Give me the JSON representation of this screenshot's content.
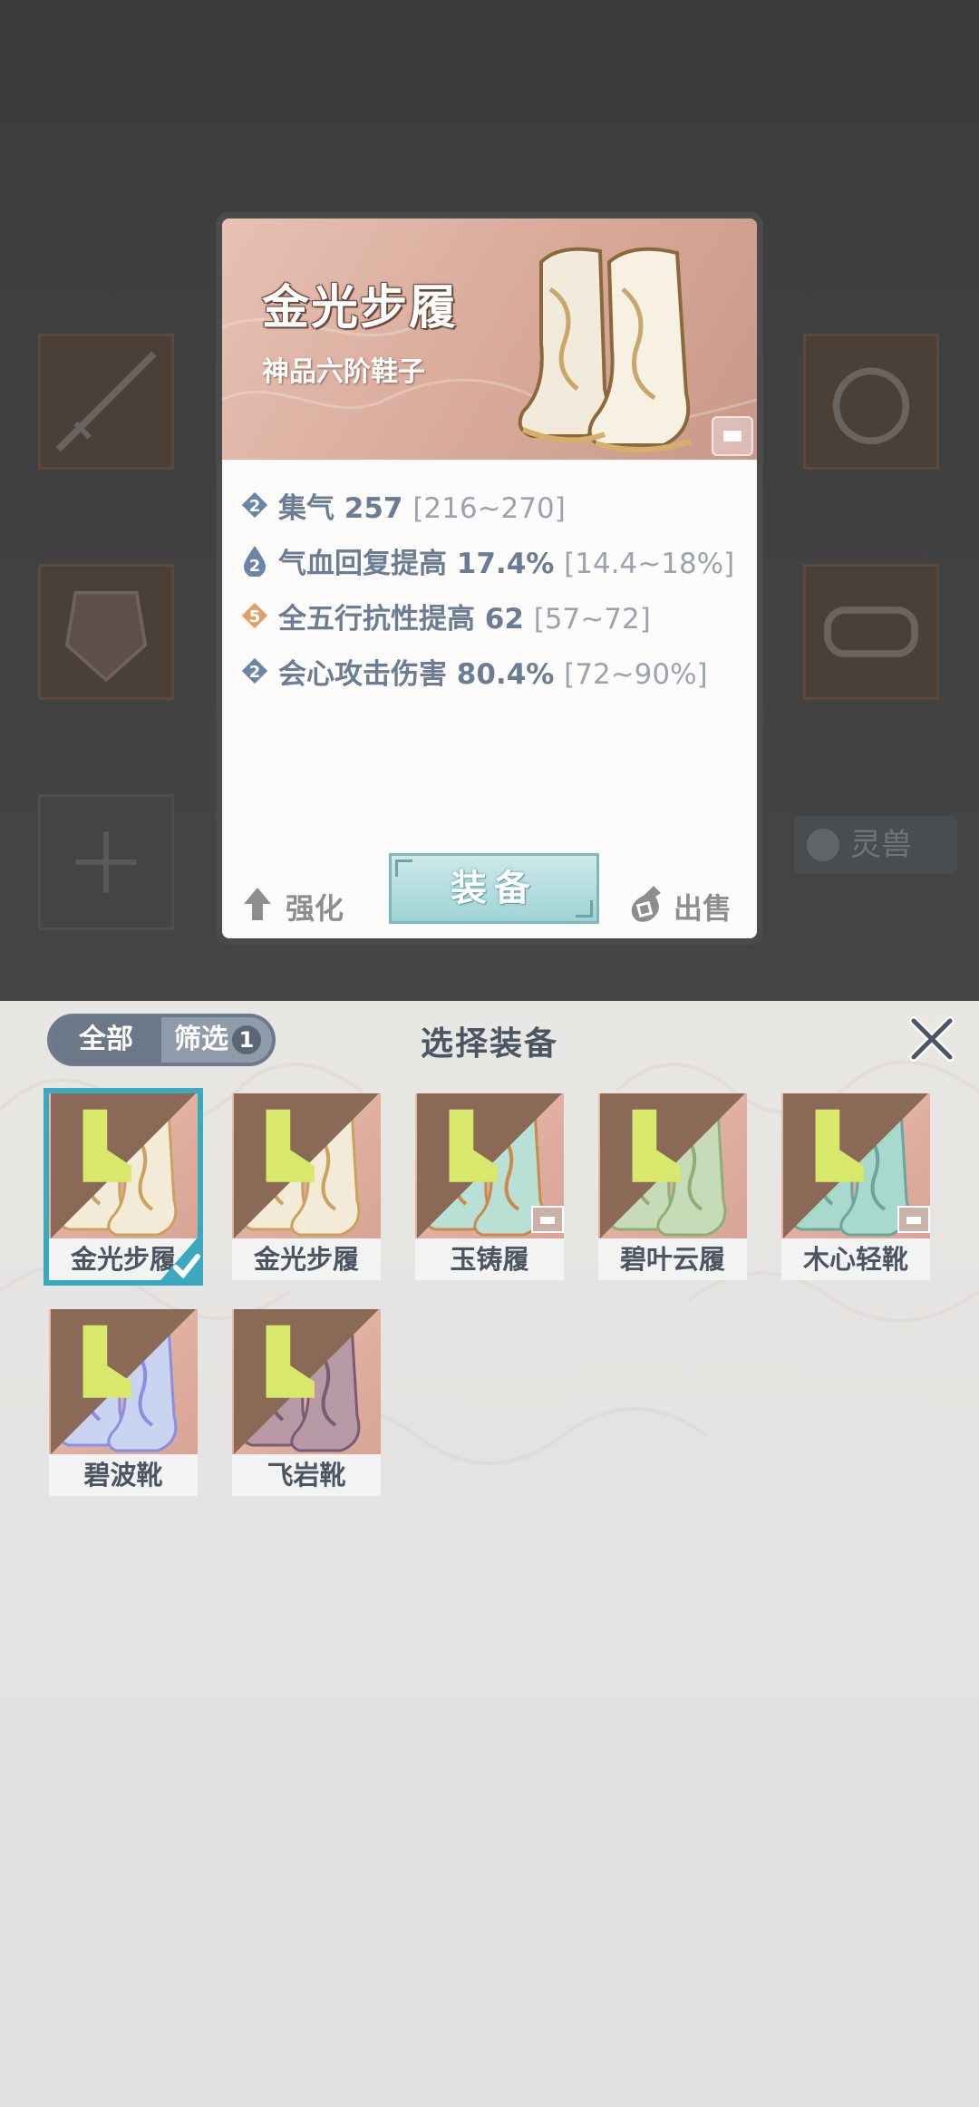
{
  "background": {
    "pet_tab_label": "灵兽"
  },
  "detail": {
    "title": "金光步履",
    "subtitle": "神品六阶鞋子",
    "stats": [
      {
        "tier": "2",
        "name_value": "集气 257",
        "range": "[216~270]",
        "badge": "diamond-blue"
      },
      {
        "tier": "2",
        "name_value": "气血回复提高 17.4%",
        "range": "[14.4~18%]",
        "badge": "drop-blue"
      },
      {
        "tier": "5",
        "name_value": "全五行抗性提高 62",
        "range": "[57~72]",
        "badge": "diamond-orange"
      },
      {
        "tier": "2",
        "name_value": "会心攻击伤害 80.4%",
        "range": "[72~90%]",
        "badge": "diamond-blue"
      }
    ],
    "enhance_label": "强化",
    "equip_label": "装备",
    "sell_label": "出售"
  },
  "panel": {
    "title": "选择装备",
    "filter_all": "全部",
    "filter_label": "筛选",
    "filter_count": "1",
    "items": [
      {
        "name": "金光步履",
        "selected": true,
        "locked": false,
        "palette": "gold"
      },
      {
        "name": "金光步履",
        "selected": false,
        "locked": false,
        "palette": "gold"
      },
      {
        "name": "玉铸履",
        "selected": false,
        "locked": true,
        "palette": "jade"
      },
      {
        "name": "碧叶云履",
        "selected": false,
        "locked": false,
        "palette": "leaf"
      },
      {
        "name": "木心轻靴",
        "selected": false,
        "locked": true,
        "palette": "teal"
      },
      {
        "name": "碧波靴",
        "selected": false,
        "locked": false,
        "palette": "wave"
      },
      {
        "name": "飞岩靴",
        "selected": false,
        "locked": false,
        "palette": "rock"
      }
    ]
  },
  "colors": {
    "accent": "#3aa8bf",
    "stat_text": "#6b7d95",
    "equip_button": "#a9d8da"
  }
}
